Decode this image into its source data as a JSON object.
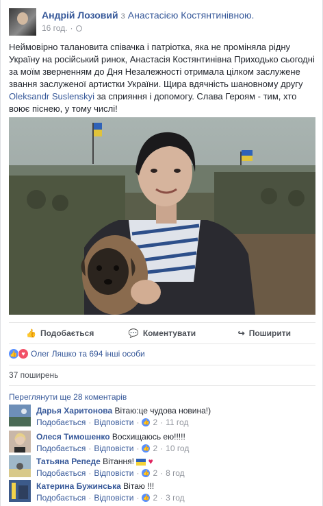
{
  "post": {
    "author": "Андрій Лозовий",
    "with_word": "з",
    "tagged": "Анастасією Костянтинівною.",
    "time": "16 год.",
    "privacy_icon": "globe-icon",
    "text_part1": "Неймовірно талановита співачка і патріотка, яка не проміняла рідну Україну на російський ринок, Анастасія Костянтинівна Приходько сьогодні за моїм зверненням до Дня Незалежності отримала цілком заслужене звання заслуженої артистки України. Щира вдячність шановному другу ",
    "text_link": "Oleksandr Suslenskyi",
    "text_part2": " за сприяння і допомогу. Слава Героям - тим, хто воює піснею, у тому числі!"
  },
  "actions": {
    "like": "Подобається",
    "comment": "Коментувати",
    "share": "Поширити"
  },
  "reactions": {
    "text": "Олег Ляшко та 694 інші особи"
  },
  "shares": "37 поширень",
  "view_more": "Переглянути ще 28 коментарів",
  "comments": [
    {
      "name": "Дарья Харитонова",
      "text": "Вітаю:це чудова новина!)",
      "like": "Подобається",
      "reply": "Відповісти",
      "likes": "2",
      "time": "11 год"
    },
    {
      "name": "Олеся Тимошенко",
      "text": "Восхищаюсь ею!!!!!",
      "like": "Подобається",
      "reply": "Відповісти",
      "likes": "2",
      "time": "10 год"
    },
    {
      "name": "Татьяна Репеде",
      "text": "Вітання!",
      "like": "Подобається",
      "reply": "Відповісти",
      "likes": "2",
      "time": "8 год"
    },
    {
      "name": "Катерина Бужинська",
      "text": "Вітаю !!!",
      "like": "Подобається",
      "reply": "Відповісти",
      "likes": "2",
      "time": "3 год"
    }
  ],
  "colors": {
    "link": "#365899",
    "meta": "#90949c",
    "like_blue": "#5890ff",
    "love_red": "#f25268"
  }
}
